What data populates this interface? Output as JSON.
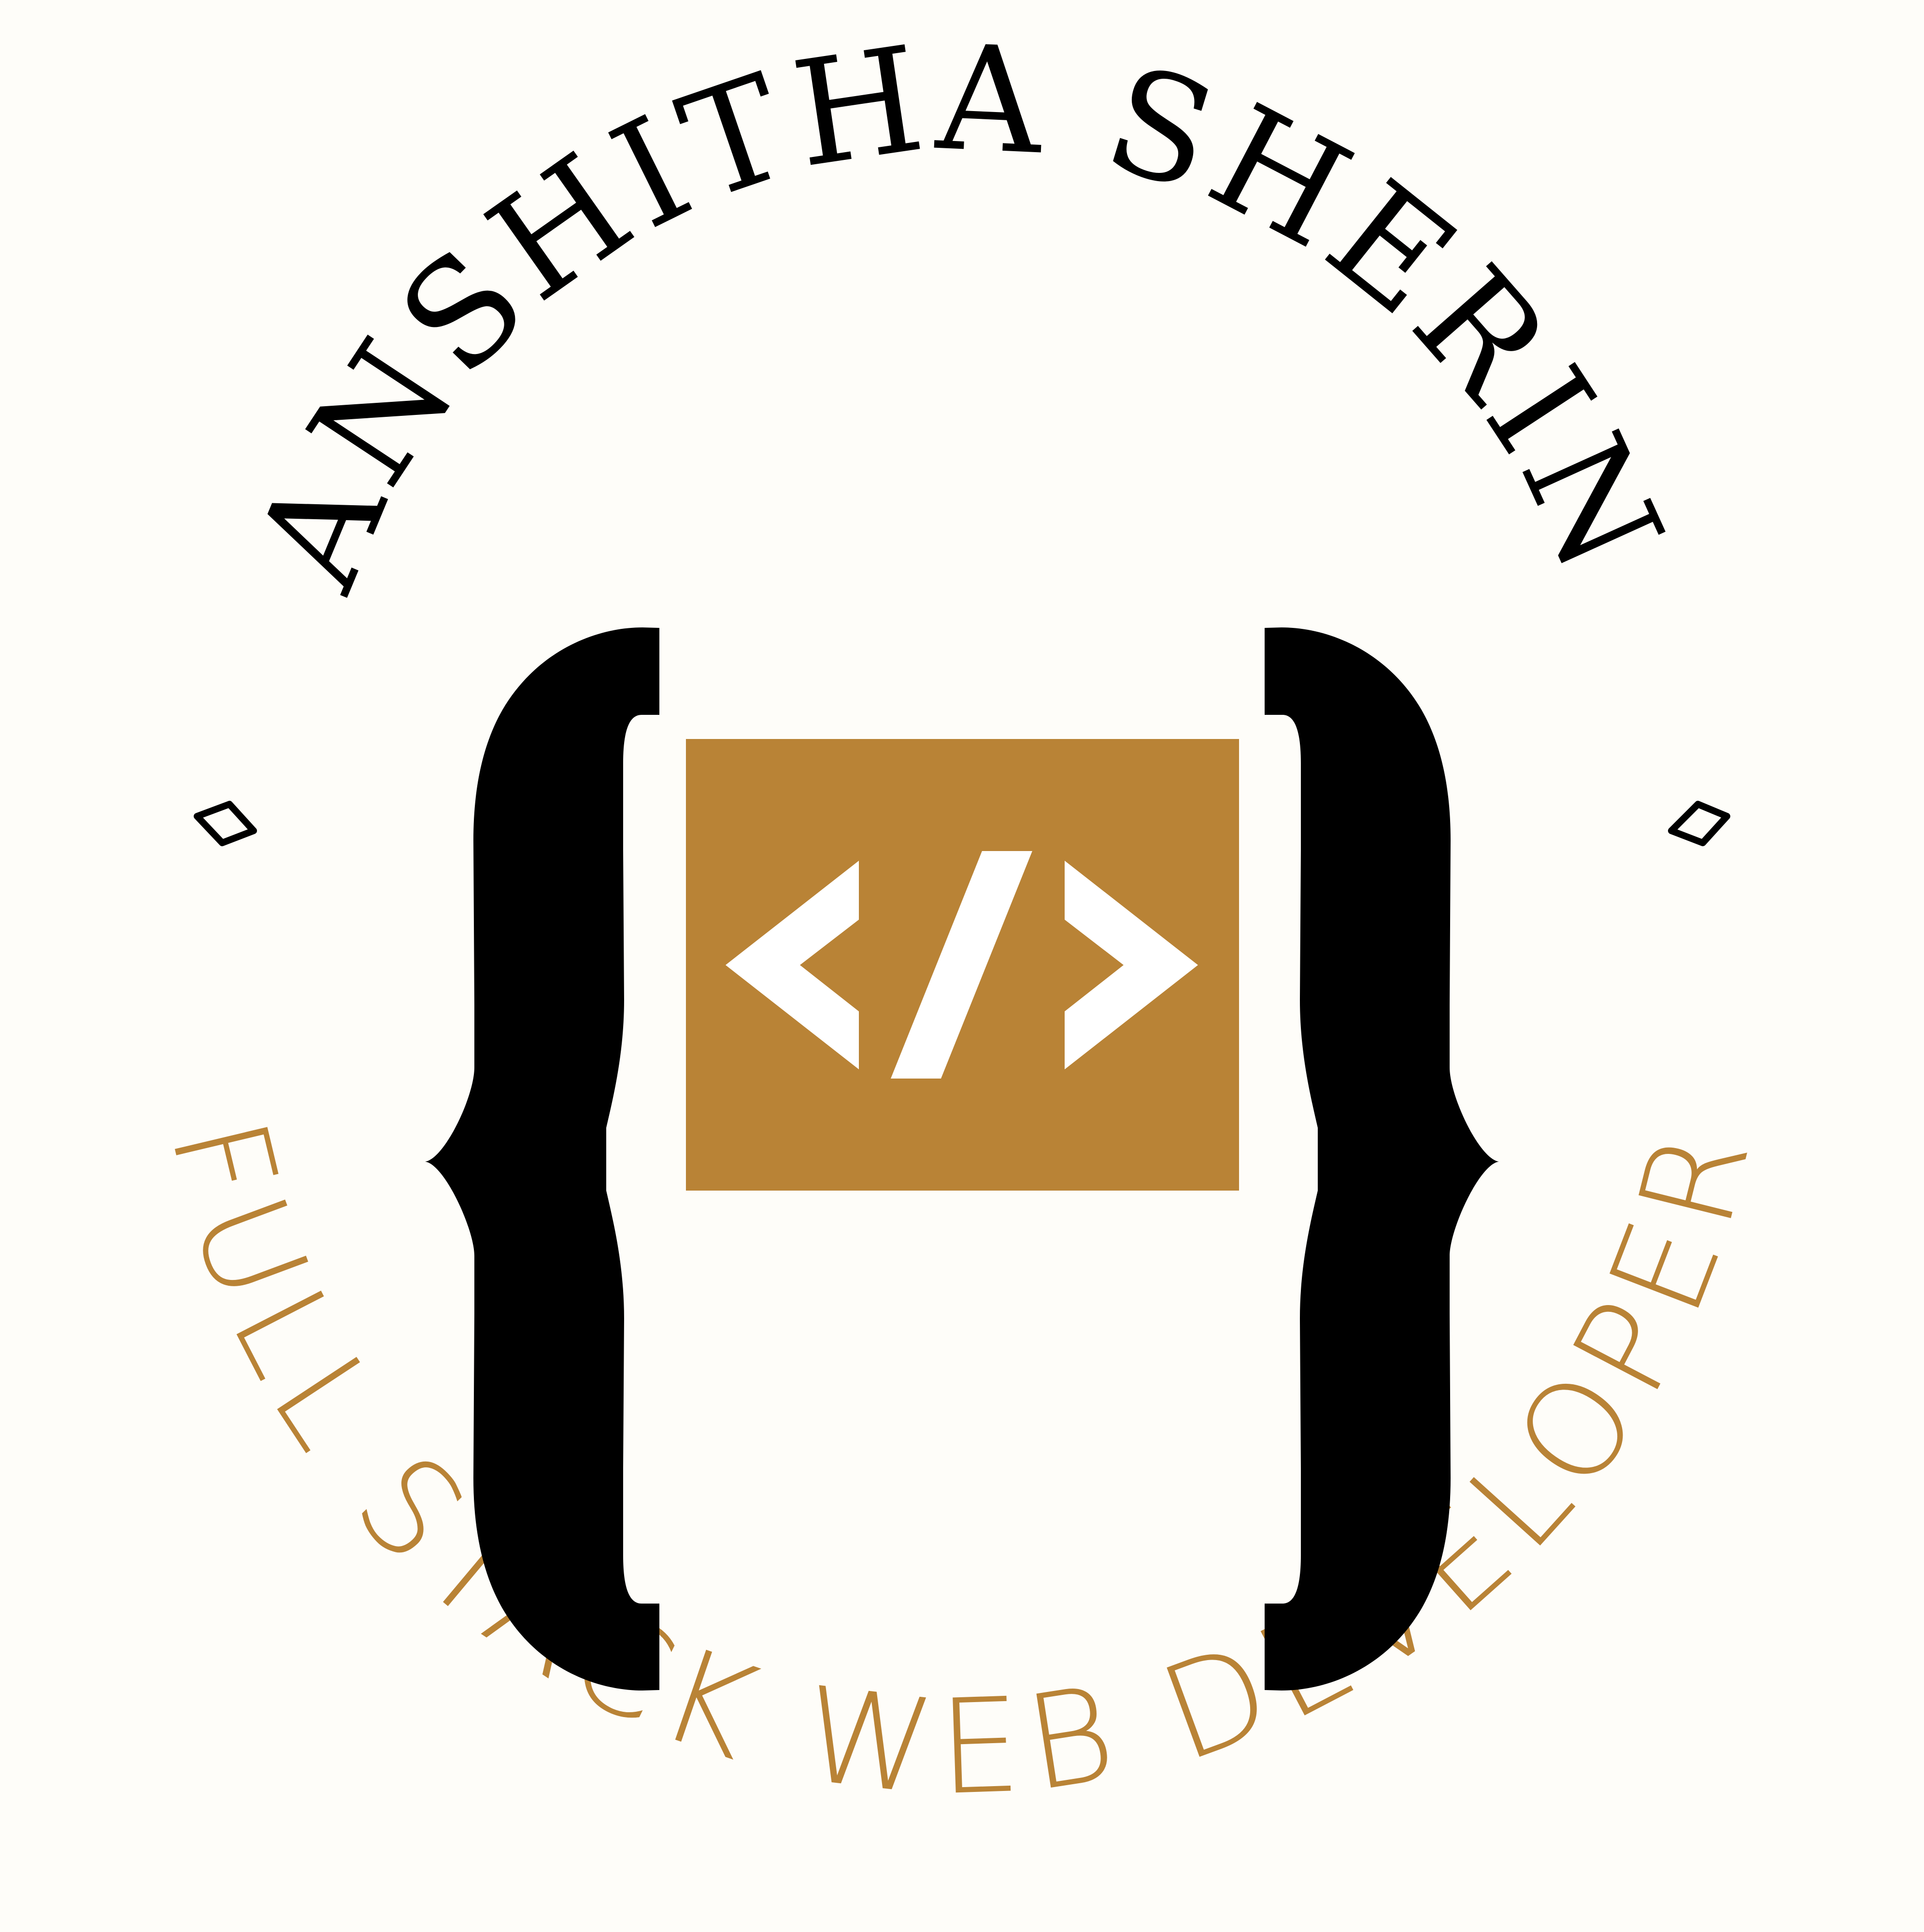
{
  "logo": {
    "name": "ANSHITHA SHERIN",
    "role": "FULL STACK WEB DEVELOPER",
    "code_symbol": "</>",
    "icons": {
      "brace_left": "left-curly-brace-icon",
      "brace_right": "right-curly-brace-icon",
      "code": "code-tag-icon",
      "diamond": "diamond-icon"
    }
  },
  "colors": {
    "background": "#fefdf9",
    "primary": "#000000",
    "accent": "#b98336",
    "symbol": "#ffffff"
  }
}
